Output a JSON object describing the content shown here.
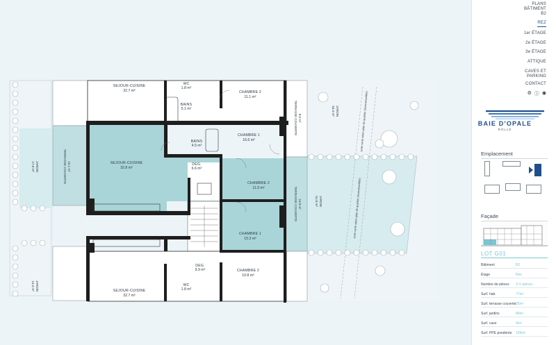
{
  "nav": {
    "plans_line1": "PLANS",
    "plans_line2": "BÂTIMENT",
    "plans_line3": "B2",
    "items": [
      "REZ",
      "1er ÉTAGE",
      "2e ÉTAGE",
      "3e ÉTAGE",
      "ATTIQUE",
      "CAVES ET",
      "PARKING",
      "CONTACT"
    ],
    "icons": [
      "gear-icon",
      "info-icon",
      "globe-icon"
    ]
  },
  "brand": {
    "name": "BAIE D'OPALE",
    "sub": "ROLLE",
    "colors": {
      "primary": "#1f4e8c",
      "accent": "#78c7d3"
    }
  },
  "emplacement": {
    "label": "Emplacement"
  },
  "facade": {
    "label": "Façade"
  },
  "lot": {
    "title": "LOT G01",
    "rows": [
      {
        "label": "Bâtiment",
        "value": "B2"
      },
      {
        "label": "Étage",
        "value": "Rez"
      },
      {
        "label": "Nombre de pièces",
        "value": "3.½ pièces"
      },
      {
        "label": "Surf. hab.",
        "value": "77m²"
      },
      {
        "label": "Surf. terrasse couverte",
        "value": "25m²"
      },
      {
        "label": "Surf. jardins",
        "value": "84m²"
      },
      {
        "label": "Surf. cave",
        "value": "4m²"
      },
      {
        "label": "Surf. PPE pondérée",
        "value": "109m²"
      }
    ]
  },
  "rooms": [
    {
      "name": "SEJOUR-CUISINE",
      "area": "32.7 m²"
    },
    {
      "name": "WC",
      "area": "1.8 m²"
    },
    {
      "name": "BAINS",
      "area": "5.1 m²"
    },
    {
      "name": "CHAMBRE 2",
      "area": "11.1 m²"
    },
    {
      "name": "CHAMBRE 1",
      "area": "16.6 m²"
    },
    {
      "name": "BAINS",
      "area": "4.5 m²"
    },
    {
      "name": "SEJOUR-CUISINE",
      "area": "32.8 m²"
    },
    {
      "name": "DEG.",
      "area": "6.6 m²"
    },
    {
      "name": "CHAMBRE 2",
      "area": "11.0 m²"
    },
    {
      "name": "CHAMBRE 1",
      "area": "15.3 m²"
    },
    {
      "name": "DEG.",
      "area": "9.9 m²"
    },
    {
      "name": "CHAMBRE 2",
      "area": "10.8 m²"
    },
    {
      "name": "WC",
      "area": "1.8 m²"
    },
    {
      "name": "SEJOUR-CUISINE",
      "area": "32.7 m²"
    }
  ],
  "plan_labels": {
    "terrasse_couverte": "TERRASSE COUVERTE",
    "terrasse_area1": "15.1 m²",
    "terrasse_area2": "10.8 m²",
    "terrasse_area3": "8.0 m²",
    "jardin": "JARDIN",
    "jardin_area_left": "17.8 m²",
    "jardin_area_right": "51.8 m²",
    "jardin_area_top": "53.3 m²",
    "jardin_area_bottom": "13.3 m²",
    "zone_verte": "zone verte selon plan de quartier (inconstructible)"
  }
}
